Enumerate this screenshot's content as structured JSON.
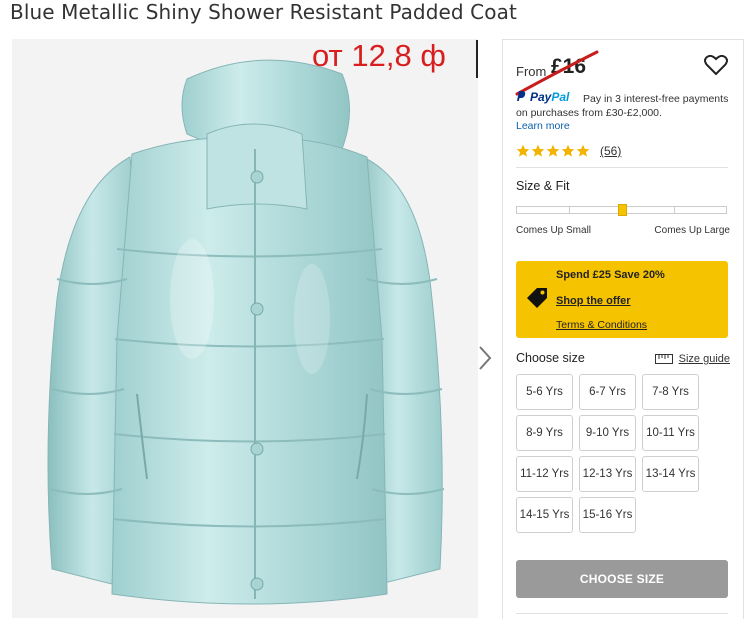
{
  "product": {
    "title": "Blue Metallic Shiny Shower Resistant Padded Coat",
    "overlay_price": "от 12,8 ф"
  },
  "pricing": {
    "from_label": "From",
    "price": "£16",
    "strike_color": "#c81d1d"
  },
  "paypal": {
    "brand_pay": "Pay",
    "brand_pal": "Pal",
    "text": "Pay in 3 interest-free payments on purchases from £30-£2,000.",
    "learn_more": "Learn more"
  },
  "rating": {
    "stars": 5,
    "review_count": "(56)"
  },
  "fit": {
    "title": "Size & Fit",
    "left_label": "Comes Up Small",
    "right_label": "Comes Up Large",
    "position_fraction": 0.5
  },
  "offer": {
    "title": "Spend £25 Save 20%",
    "shop_link": "Shop the offer",
    "terms_link": "Terms & Conditions",
    "background": "#f6c300"
  },
  "sizes": {
    "label": "Choose size",
    "guide_link": "Size guide",
    "options": [
      "5-6 Yrs",
      "6-7 Yrs",
      "7-8 Yrs",
      "8-9 Yrs",
      "9-10 Yrs",
      "10-11 Yrs",
      "11-12 Yrs",
      "12-13 Yrs",
      "13-14 Yrs",
      "14-15 Yrs",
      "15-16 Yrs"
    ]
  },
  "actions": {
    "choose_size": "CHOOSE SIZE"
  },
  "icons": {
    "heart": "heart-icon",
    "next": "chevron-right-icon",
    "tag": "tag-icon",
    "ruler": "ruler-icon",
    "star": "star-icon",
    "paypal": "paypal-icon"
  }
}
